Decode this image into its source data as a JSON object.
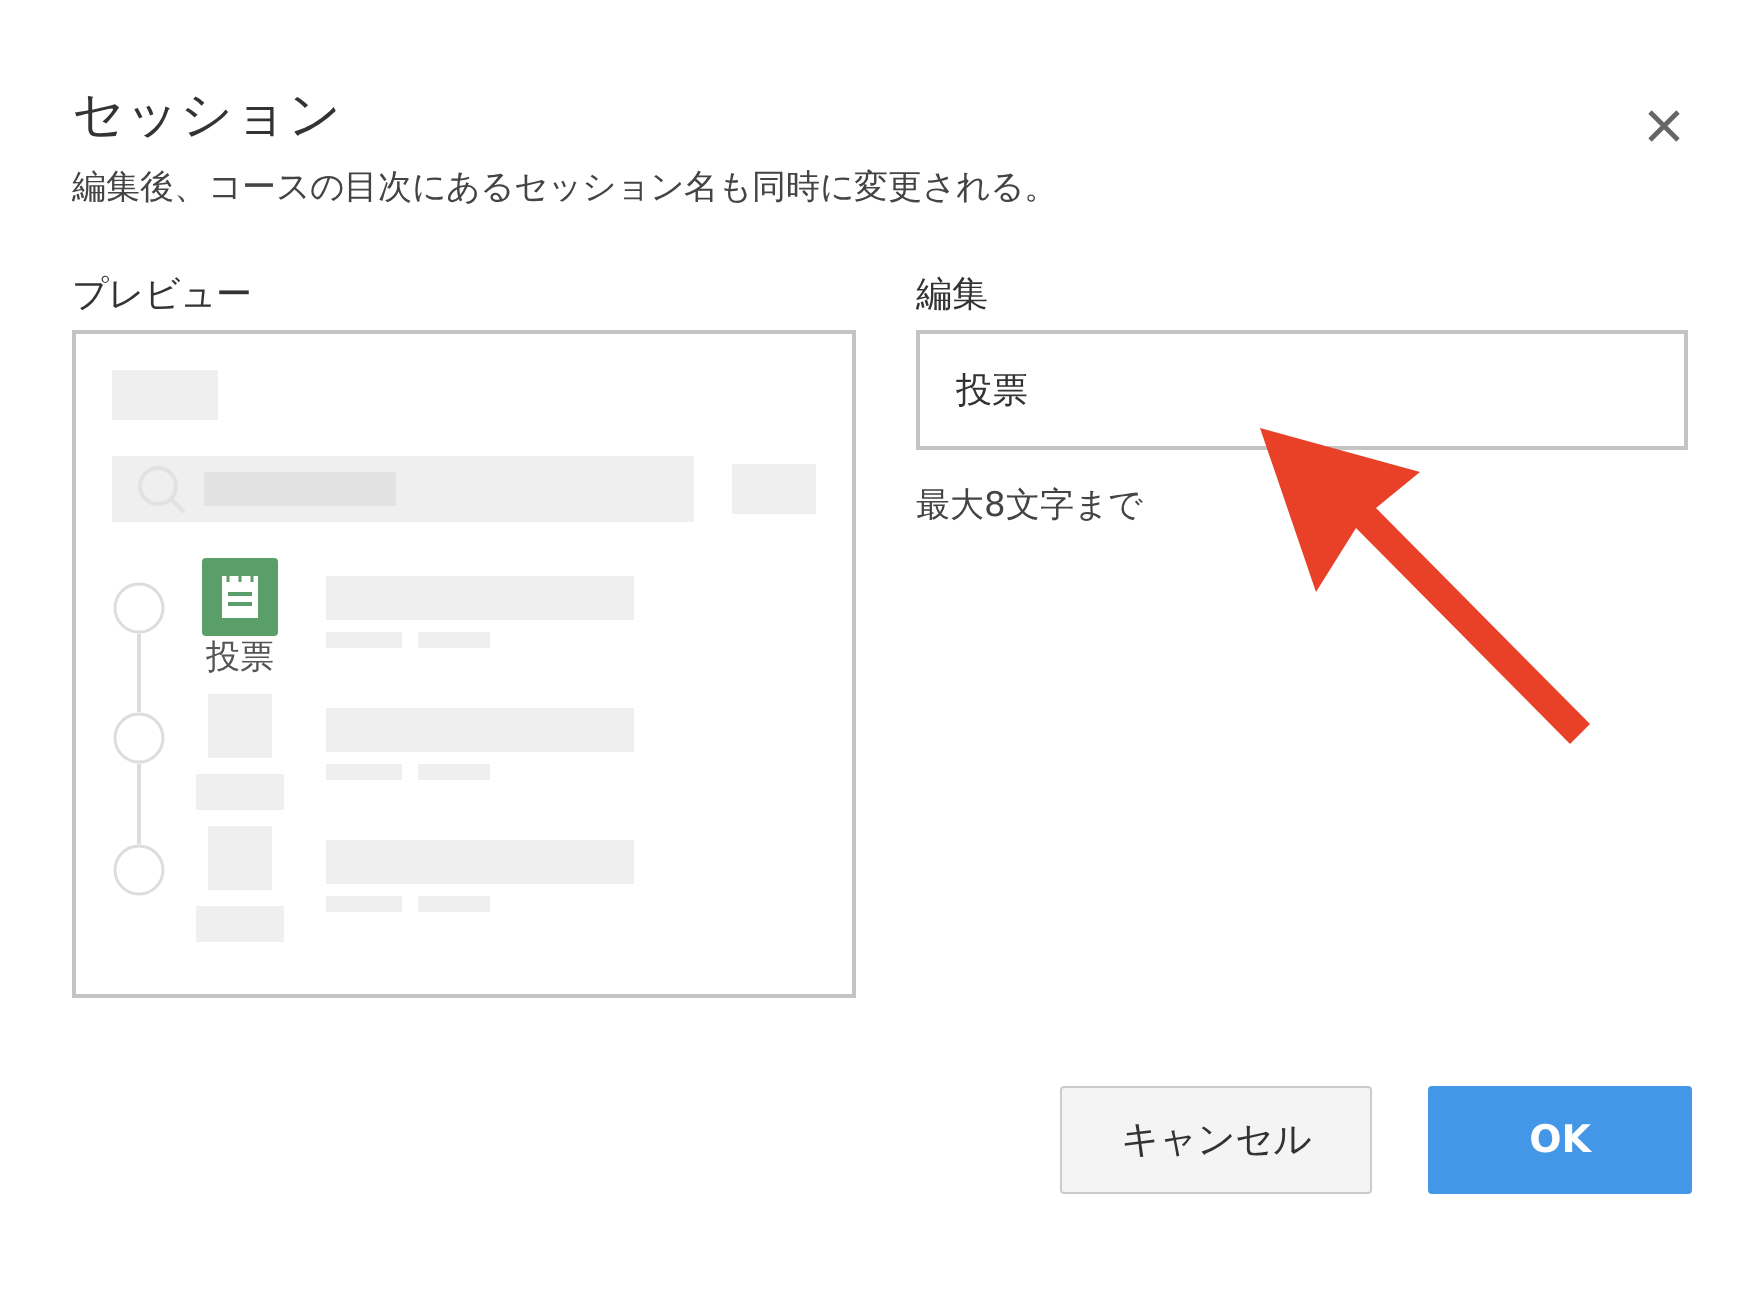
{
  "dialog": {
    "title": "セッション",
    "subtitle": "編集後、コースの目次にあるセッション名も同時に変更される。"
  },
  "preview": {
    "label": "プレビュー",
    "item_label": "投票"
  },
  "edit": {
    "label": "編集",
    "value": "投票",
    "hint": "最大8文字まで"
  },
  "buttons": [
    {
      "label": "キャンセル",
      "kind": "secondary"
    },
    {
      "label": "OK",
      "kind": "primary"
    }
  ]
}
